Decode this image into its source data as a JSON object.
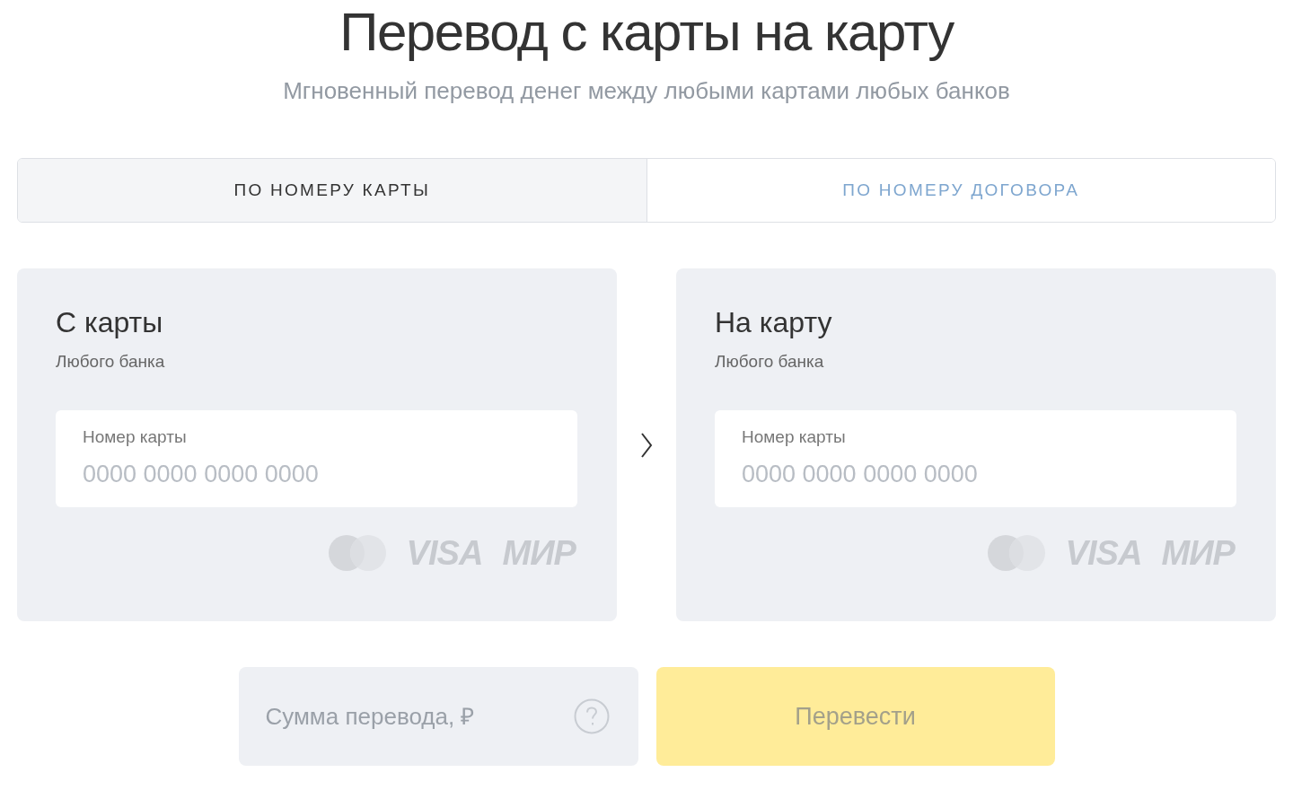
{
  "header": {
    "title": "Перевод с карты на карту",
    "subtitle": "Мгновенный перевод денег между любыми картами любых банков"
  },
  "tabs": [
    {
      "label": "ПО НОМЕРУ КАРТЫ",
      "selected": true
    },
    {
      "label": "ПО НОМЕРУ ДОГОВОРА",
      "selected": false
    }
  ],
  "cards": [
    {
      "title": "С карты",
      "subtitle": "Любого банка",
      "field": {
        "label": "Номер карты",
        "placeholder": "0000 0000 0000 0000"
      },
      "logos": [
        "VISA",
        "МИР"
      ]
    },
    {
      "title": "На карту",
      "subtitle": "Любого банка",
      "field": {
        "label": "Номер карты",
        "placeholder": "0000 0000 0000 0000"
      },
      "logos": [
        "VISA",
        "МИР"
      ]
    }
  ],
  "amount": {
    "placeholder": "Сумма перевода, ₽"
  },
  "submit": {
    "label": "Перевести",
    "disabled": true
  }
}
